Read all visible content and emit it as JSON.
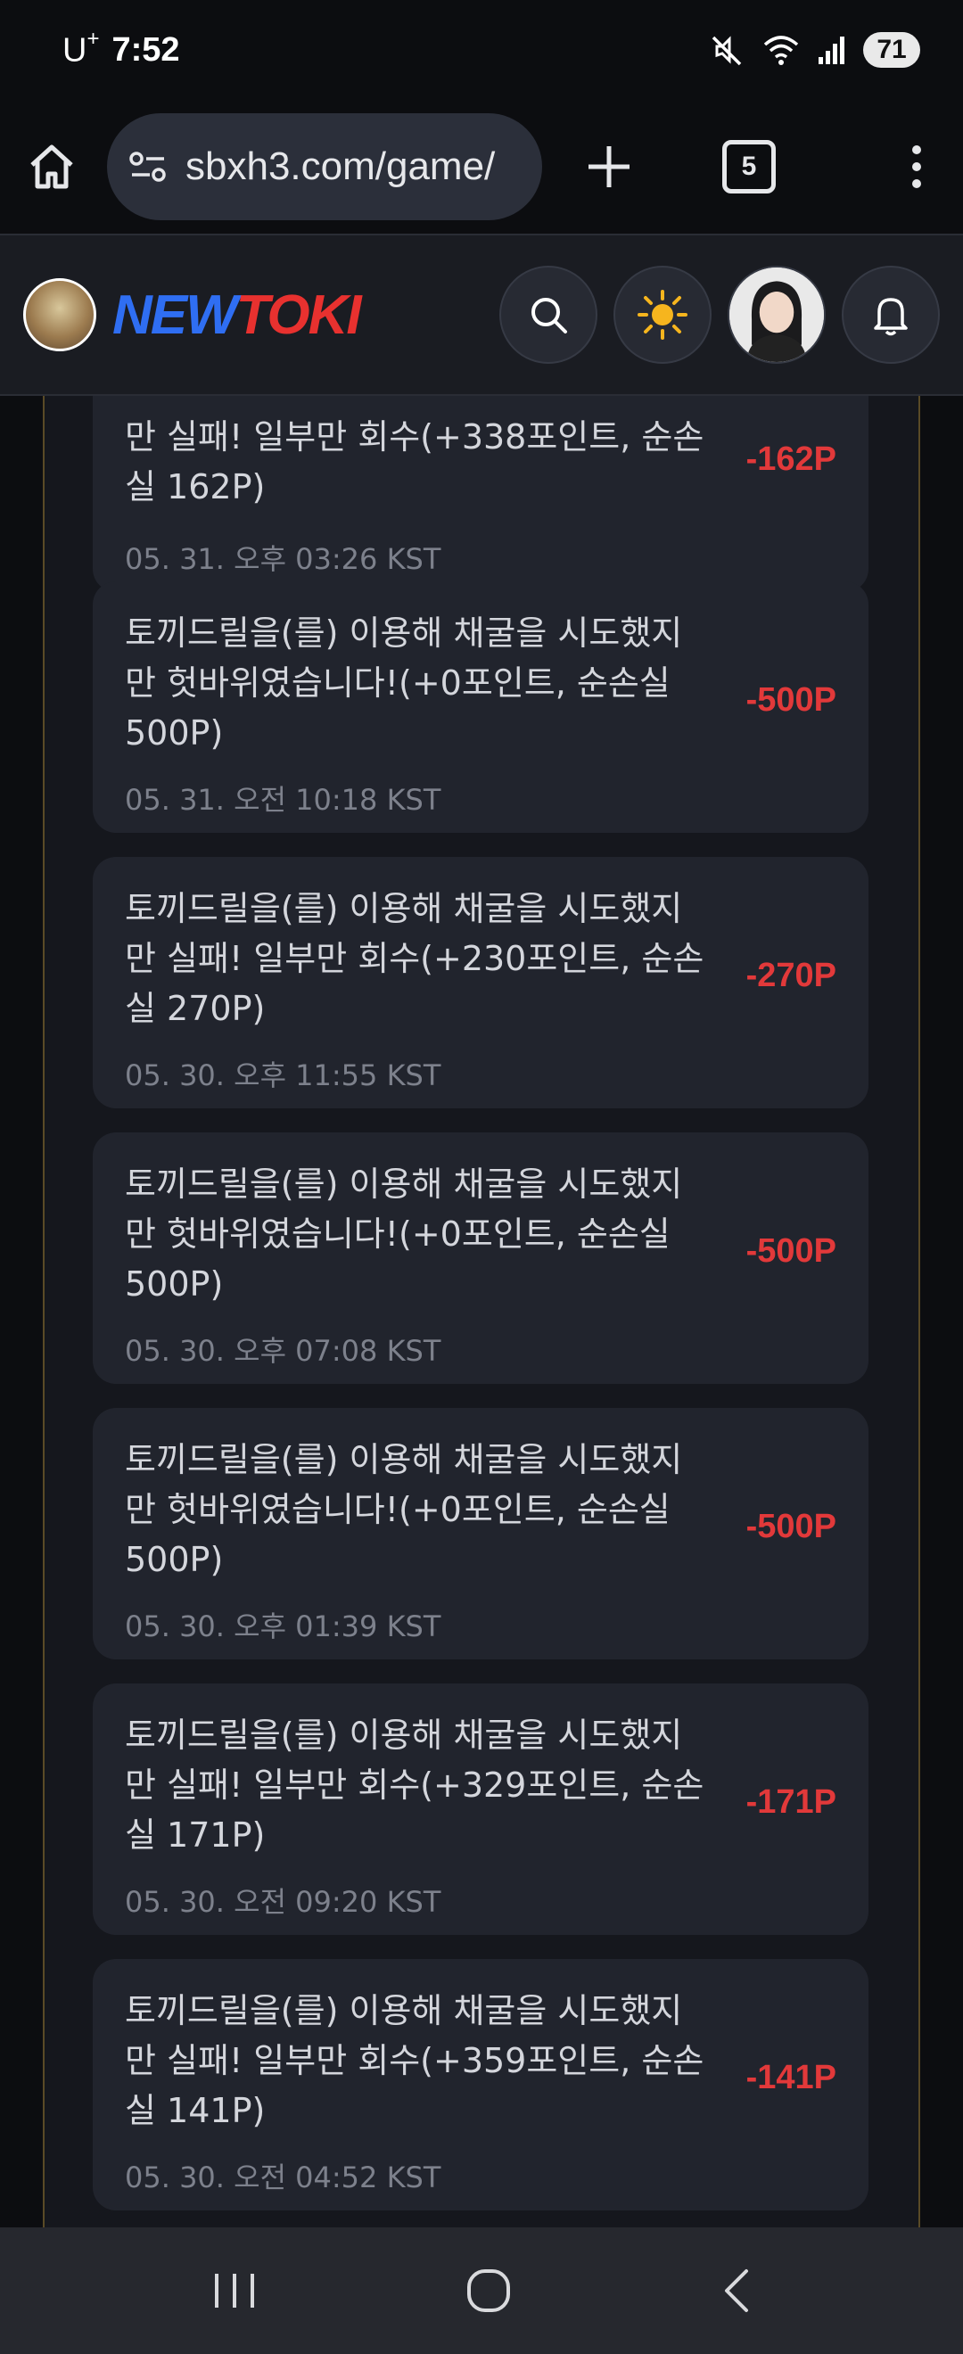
{
  "status_bar": {
    "carrier": "U",
    "carrier_sup": "+",
    "time": "7:52",
    "battery": "71"
  },
  "browser": {
    "url": "sbxh3.com/game/",
    "tab_count": "5"
  },
  "site": {
    "logo_new": "NEW",
    "logo_toki": "TOKI"
  },
  "records": [
    {
      "message": "만 실패! 일부만 회수(+338포인트, 순손\n실 162P)",
      "time": "05. 31. 오후 03:26 KST",
      "amount": "-162P"
    },
    {
      "message": "토끼드릴을(를) 이용해 채굴을 시도했지\n만 헛바위였습니다!(+0포인트, 순손실\n500P)",
      "time": "05. 31. 오전 10:18 KST",
      "amount": "-500P"
    },
    {
      "message": "토끼드릴을(를) 이용해 채굴을 시도했지\n만 실패! 일부만 회수(+230포인트, 순손\n실 270P)",
      "time": "05. 30. 오후 11:55 KST",
      "amount": "-270P"
    },
    {
      "message": "토끼드릴을(를) 이용해 채굴을 시도했지\n만 헛바위였습니다!(+0포인트, 순손실\n500P)",
      "time": "05. 30. 오후 07:08 KST",
      "amount": "-500P"
    },
    {
      "message": "토끼드릴을(를) 이용해 채굴을 시도했지\n만 헛바위였습니다!(+0포인트, 순손실\n500P)",
      "time": "05. 30. 오후 01:39 KST",
      "amount": "-500P"
    },
    {
      "message": "토끼드릴을(를) 이용해 채굴을 시도했지\n만 실패! 일부만 회수(+329포인트, 순손\n실 171P)",
      "time": "05. 30. 오전 09:20 KST",
      "amount": "-171P"
    },
    {
      "message": "토끼드릴을(를) 이용해 채굴을 시도했지\n만 실패! 일부만 회수(+359포인트, 순손\n실 141P)",
      "time": "05. 30. 오전 04:52 KST",
      "amount": "-141P"
    }
  ],
  "colors": {
    "accent_red": "#e2393a",
    "logo_blue": "#2f6ef2",
    "logo_red": "#e8312f"
  }
}
